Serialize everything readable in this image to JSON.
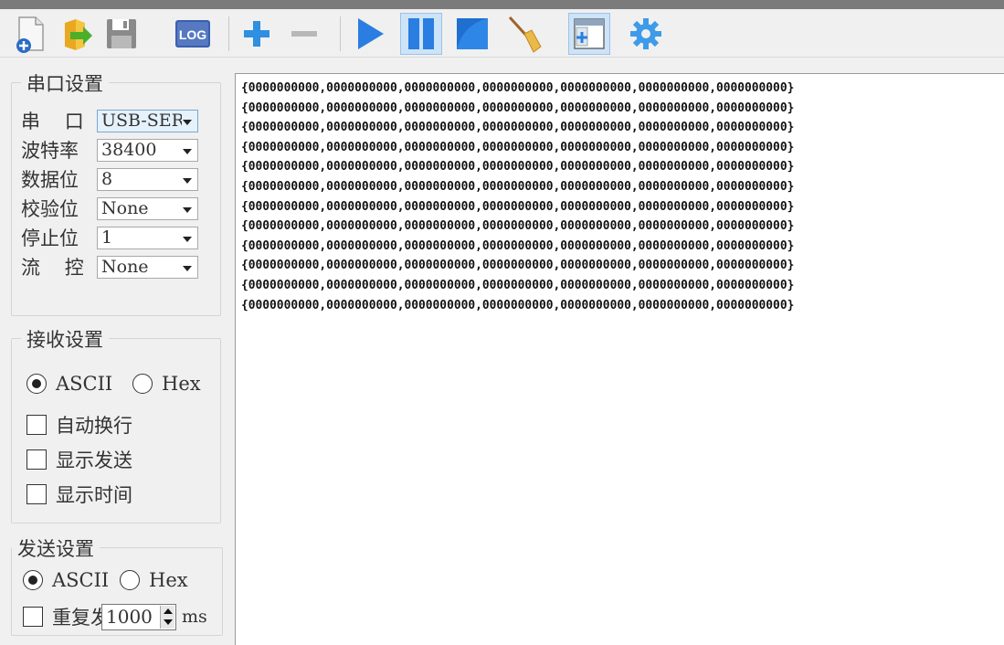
{
  "toolbar": {
    "buttons": [
      {
        "name": "new-file-icon"
      },
      {
        "name": "open-folder-icon"
      },
      {
        "name": "save-disk-icon"
      },
      {
        "name": "log-icon",
        "label": "LOG"
      },
      {
        "name": "add-icon"
      },
      {
        "name": "remove-icon"
      },
      {
        "name": "play-icon"
      },
      {
        "name": "pause-icon"
      },
      {
        "name": "stop-icon"
      },
      {
        "name": "broom-icon"
      },
      {
        "name": "add-window-icon"
      },
      {
        "name": "settings-gear-icon"
      }
    ]
  },
  "serial": {
    "title": "串口设置",
    "port_label": "串    口",
    "port_value": "USB-SER",
    "baud_label": "波特率",
    "baud_value": "38400",
    "databits_label": "数据位",
    "databits_value": "8",
    "parity_label": "校验位",
    "parity_value": "None",
    "stopbits_label": "停止位",
    "stopbits_value": "1",
    "flow_label": "流    控",
    "flow_value": "None"
  },
  "receive": {
    "title": "接收设置",
    "ascii_label": "ASCII",
    "hex_label": "Hex",
    "ascii_selected": true,
    "autowrap_label": "自动换行",
    "showsend_label": "显示发送",
    "showtime_label": "显示时间"
  },
  "send": {
    "title": "发送设置",
    "ascii_label": "ASCII",
    "hex_label": "Hex",
    "ascii_selected": true,
    "repeat_label": "重复发",
    "repeat_value": "1000",
    "unit_label": "ms"
  },
  "receive_area": {
    "lines": [
      "{0000000000,0000000000,0000000000,0000000000,0000000000,0000000000,0000000000}",
      "{0000000000,0000000000,0000000000,0000000000,0000000000,0000000000,0000000000}",
      "{0000000000,0000000000,0000000000,0000000000,0000000000,0000000000,0000000000}",
      "{0000000000,0000000000,0000000000,0000000000,0000000000,0000000000,0000000000}",
      "{0000000000,0000000000,0000000000,0000000000,0000000000,0000000000,0000000000}",
      "{0000000000,0000000000,0000000000,0000000000,0000000000,0000000000,0000000000}",
      "{0000000000,0000000000,0000000000,0000000000,0000000000,0000000000,0000000000}",
      "{0000000000,0000000000,0000000000,0000000000,0000000000,0000000000,0000000000}",
      "{0000000000,0000000000,0000000000,0000000000,0000000000,0000000000,0000000000}",
      "{0000000000,0000000000,0000000000,0000000000,0000000000,0000000000,0000000000}",
      "{0000000000,0000000000,0000000000,0000000000,0000000000,0000000000,0000000000}",
      "{0000000000,0000000000,0000000000,0000000000,0000000000,0000000000,0000000000}"
    ]
  }
}
